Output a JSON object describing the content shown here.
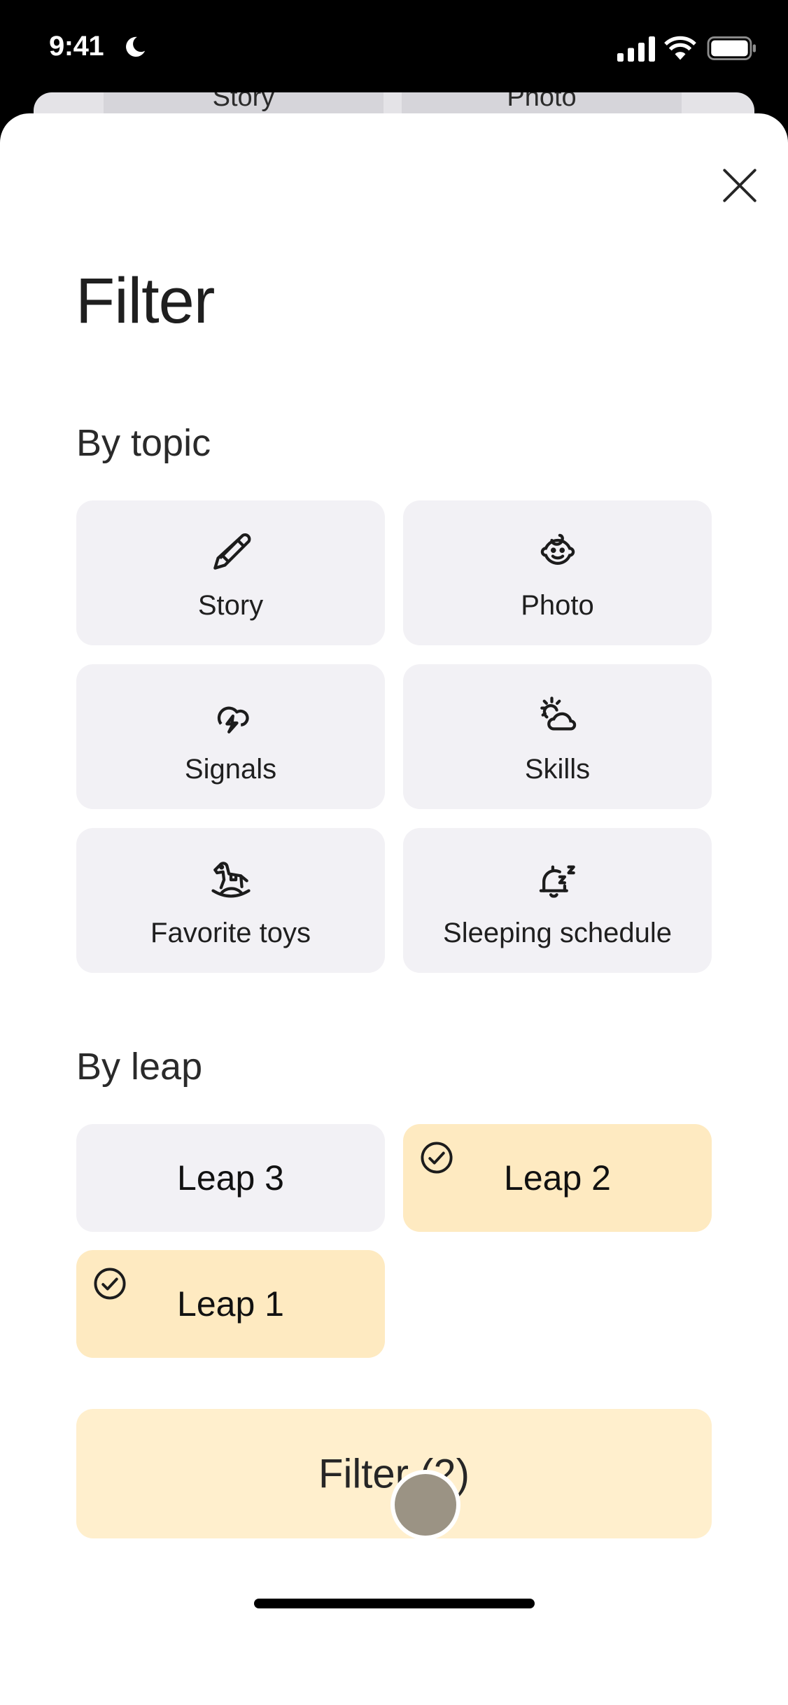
{
  "status_bar": {
    "time": "9:41",
    "focus_icon": "moon-icon",
    "signal_icon": "cellular-signal-icon",
    "wifi_icon": "wifi-icon",
    "battery_icon": "battery-icon"
  },
  "background_screen": {
    "tabs": [
      "Story",
      "Photo"
    ]
  },
  "sheet": {
    "close_icon": "close-icon",
    "title": "Filter",
    "by_topic": {
      "heading": "By topic",
      "items": [
        {
          "label": "Story",
          "icon": "pencil-icon"
        },
        {
          "label": "Photo",
          "icon": "baby-face-icon"
        },
        {
          "label": "Signals",
          "icon": "storm-cloud-icon"
        },
        {
          "label": "Skills",
          "icon": "sun-cloud-icon"
        },
        {
          "label": "Favorite toys",
          "icon": "rocking-horse-icon"
        },
        {
          "label": "Sleeping schedule",
          "icon": "sleep-bell-icon"
        }
      ]
    },
    "by_leap": {
      "heading": "By leap",
      "items": [
        {
          "label": "Leap 3",
          "selected": false
        },
        {
          "label": "Leap 2",
          "selected": true
        },
        {
          "label": "Leap 1",
          "selected": true
        }
      ]
    },
    "filter_button": {
      "label": "Filter (2)"
    }
  },
  "colors": {
    "tile_bg": "#f2f1f5",
    "selected_bg": "#feeac1",
    "button_bg": "#ffefcd"
  }
}
